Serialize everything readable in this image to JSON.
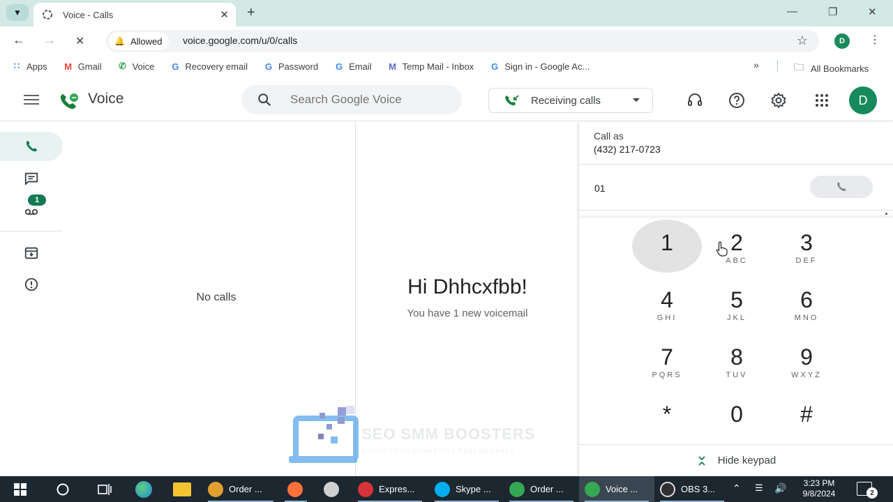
{
  "browser": {
    "tab_title": "Voice - Calls",
    "new_tab": "+",
    "permission_chip": "Allowed",
    "url": "voice.google.com/u/0/calls",
    "profile_initial": "D",
    "bookmarks": [
      {
        "label": "Apps",
        "icon": "apps-grid-icon"
      },
      {
        "label": "Gmail",
        "icon": "gmail-icon"
      },
      {
        "label": "Voice",
        "icon": "voice-icon"
      },
      {
        "label": "Recovery email",
        "icon": "google-icon"
      },
      {
        "label": "Password",
        "icon": "google-icon"
      },
      {
        "label": "Email",
        "icon": "google-icon"
      },
      {
        "label": "Temp Mail - Inbox",
        "icon": "mail-icon"
      },
      {
        "label": "Sign in - Google Ac...",
        "icon": "google-icon"
      }
    ],
    "bookmarks_overflow": "»",
    "all_bookmarks": "All Bookmarks"
  },
  "app": {
    "name": "Voice",
    "search_placeholder": "Search Google Voice",
    "receiving_label": "Receiving calls",
    "avatar_initial": "D",
    "voicemail_badge": "1",
    "accent": "#137a54"
  },
  "calls_panel": {
    "empty_text": "No calls"
  },
  "welcome": {
    "greeting": "Hi Dhhcxfbb!",
    "subtext": "You have 1 new voicemail"
  },
  "dialer": {
    "call_as_label": "Call as",
    "call_as_number": "(432) 217-0723",
    "input_value": "01",
    "keys": [
      {
        "digit": "1",
        "letters": ""
      },
      {
        "digit": "2",
        "letters": "ABC"
      },
      {
        "digit": "3",
        "letters": "DEF"
      },
      {
        "digit": "4",
        "letters": "GHI"
      },
      {
        "digit": "5",
        "letters": "JKL"
      },
      {
        "digit": "6",
        "letters": "MNO"
      },
      {
        "digit": "7",
        "letters": "PQRS"
      },
      {
        "digit": "8",
        "letters": "TUV"
      },
      {
        "digit": "9",
        "letters": "WXYZ"
      },
      {
        "digit": "*",
        "letters": ""
      },
      {
        "digit": "0",
        "letters": ""
      },
      {
        "digit": "#",
        "letters": ""
      }
    ],
    "hide_keypad": "Hide keypad"
  },
  "watermark": {
    "title": "SEO SMM BOOSTERS",
    "tagline": "BOOST YOUR MARKETING PERFORMANCE"
  },
  "taskbar": {
    "items": [
      {
        "label": "Order ...",
        "color": "#e0a030"
      },
      {
        "label": "",
        "color": "#ff7139"
      },
      {
        "label": "",
        "color": "#d0d0d0"
      },
      {
        "label": "Expres...",
        "color": "#d8323a"
      },
      {
        "label": "Skype ...",
        "color": "#00aff0"
      },
      {
        "label": "Order ...",
        "color": "#34a853"
      },
      {
        "label": "Voice ...",
        "color": "#34a853"
      },
      {
        "label": "OBS 3...",
        "color": "#302e31"
      }
    ],
    "time": "3:23 PM",
    "date": "9/8/2024",
    "notification_count": "2"
  }
}
